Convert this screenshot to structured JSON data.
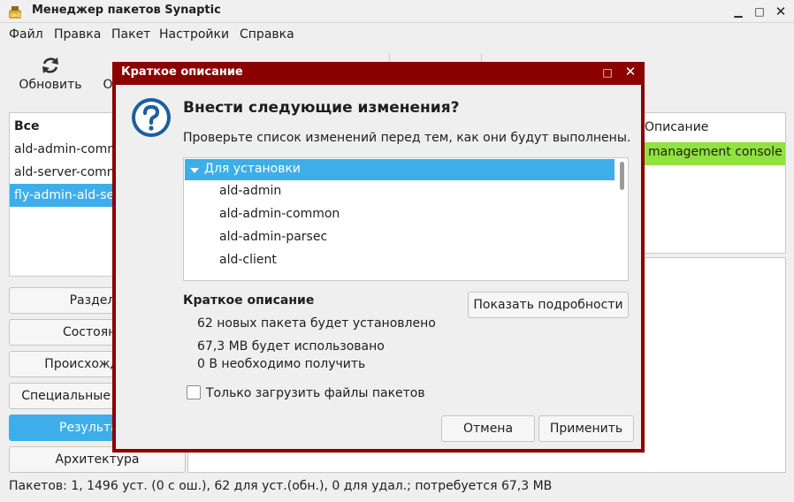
{
  "window": {
    "title": "Менеджер пакетов Synaptic",
    "app_icon": "synaptic-deb-icon"
  },
  "menubar": [
    "Файл",
    "Правка",
    "Пакет",
    "Настройки",
    "Справка"
  ],
  "toolbar": {
    "reload_label": "Обновить",
    "reload_icon": "reload-icon",
    "second_label_partial": "О"
  },
  "sidebar": {
    "filters": [
      {
        "label": "Все"
      },
      {
        "label": "ald-admin-common"
      },
      {
        "label": "ald-server-common"
      },
      {
        "label": "fly-admin-ald-se"
      }
    ],
    "buttons": [
      "Разделы",
      "Состояние",
      "Происхождение",
      "Специальные фильтры",
      "Результаты",
      "Архитектура"
    ],
    "active_button": "Результаты"
  },
  "table": {
    "description_header": "Описание",
    "highlighted_row_description": "management console"
  },
  "status_bar": "Пакетов: 1, 1496 уст. (0 с ош.), 62 для уст.(обн.), 0 для удал.; потребуется 67,3 MB",
  "dialog": {
    "title": "Краткое описание",
    "icon": "question-icon",
    "heading": "Внести следующие изменения?",
    "subtext": "Проверьте список изменений перед тем, как они будут выполнены.",
    "tree": {
      "group_label": "Для установки",
      "items": [
        "ald-admin",
        "ald-admin-common",
        "ald-admin-parsec",
        "ald-client"
      ]
    },
    "summary": {
      "title": "Краткое описание",
      "lines": [
        "62 новых пакета будет установлено",
        "67,3 MB будет использовано",
        "0  B необходимо получить"
      ]
    },
    "details_button": "Показать подробности",
    "download_only_label": "Только загрузить файлы пакетов",
    "download_only_checked": false,
    "cancel_button": "Отмена",
    "apply_button": "Применить"
  },
  "colors": {
    "selection": "#3daee9",
    "dialog_border": "#8b0000",
    "row_highlight": "#8fe23f"
  }
}
